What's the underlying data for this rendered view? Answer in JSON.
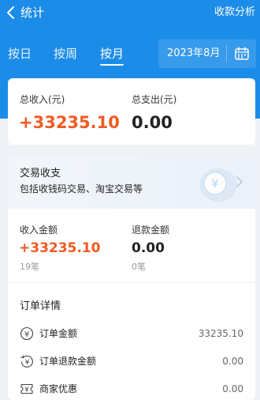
{
  "header": {
    "title": "统计",
    "action": "收款分析"
  },
  "tabs": [
    {
      "label": "按日"
    },
    {
      "label": "按周"
    },
    {
      "label": "按月",
      "active": true
    }
  ],
  "month_picker": {
    "value": "2023年8月",
    "icon": "calendar-icon"
  },
  "summary": {
    "income_label": "总收入(元)",
    "income_value": "+33235.10",
    "expense_label": "总支出(元)",
    "expense_value": "0.00"
  },
  "trade": {
    "title": "交易收支",
    "desc": "包括收钱码交易、淘宝交易等",
    "income_label": "收入金额",
    "income_value": "+33235.10",
    "income_count": "19笔",
    "refund_label": "退款金额",
    "refund_value": "0.00",
    "refund_count": "0笔"
  },
  "order_details": {
    "title": "订单详情",
    "rows": [
      {
        "label": "订单金额",
        "value": "33235.10",
        "icon": "yen-circle-icon"
      },
      {
        "label": "订单退款金额",
        "value": "0.00",
        "icon": "refund-icon"
      },
      {
        "label": "商家优惠",
        "value": "0.00",
        "icon": "coupon-icon"
      }
    ]
  },
  "colors": {
    "brand_blue": "#1c8ce9",
    "income_orange": "#f05a22",
    "background": "#eef1f5"
  }
}
